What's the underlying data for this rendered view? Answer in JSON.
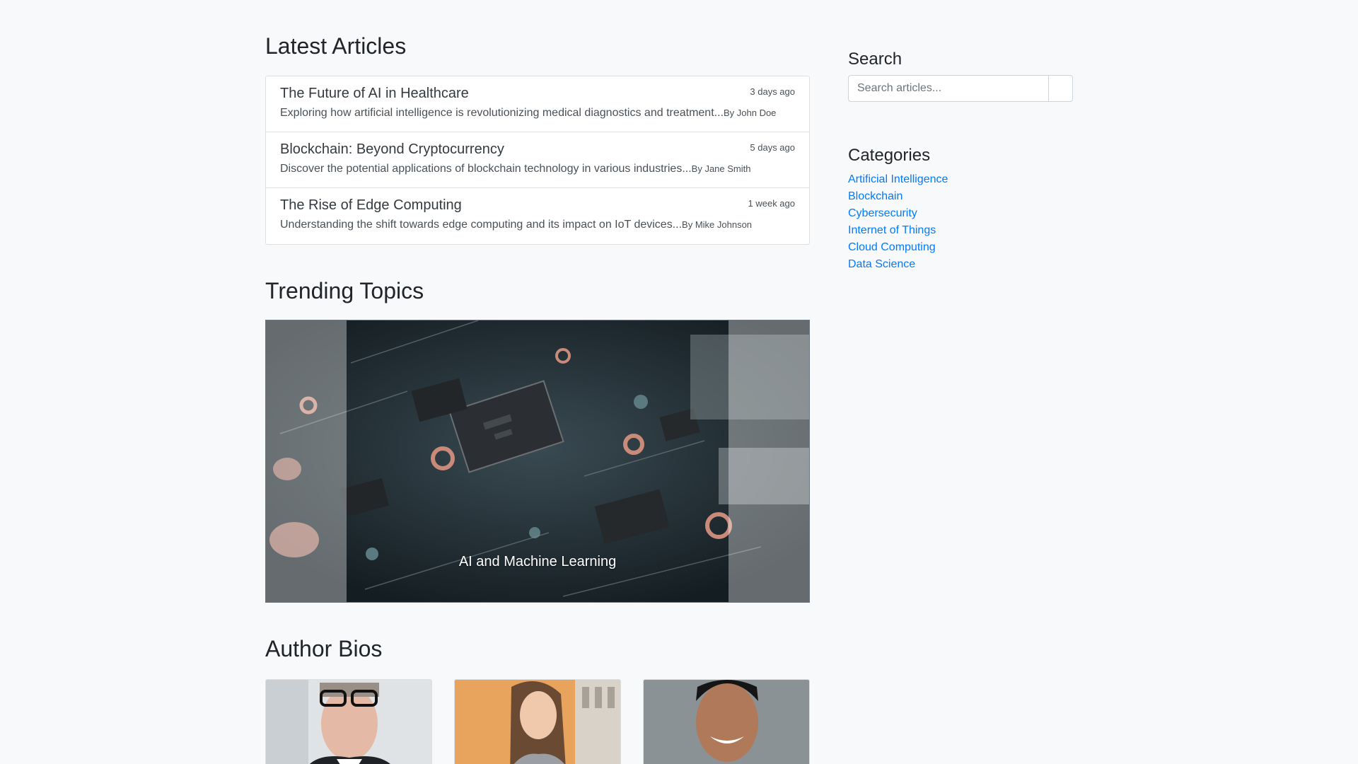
{
  "latest": {
    "title": "Latest Articles",
    "articles": [
      {
        "title": "The Future of AI in Healthcare",
        "time": "3 days ago",
        "description": "Exploring how artificial intelligence is revolutionizing medical diagnostics and treatment...",
        "author": "By John Doe"
      },
      {
        "title": "Blockchain: Beyond Cryptocurrency",
        "time": "5 days ago",
        "description": "Discover the potential applications of blockchain technology in various industries...",
        "author": "By Jane Smith"
      },
      {
        "title": "The Rise of Edge Computing",
        "time": "1 week ago",
        "description": "Understanding the shift towards edge computing and its impact on IoT devices...",
        "author": "By Mike Johnson"
      }
    ]
  },
  "trending": {
    "title": "Trending Topics",
    "slide_caption": "AI and Machine Learning",
    "colors": {
      "board": "#1c2a30",
      "chip": "#2b2f33",
      "copper": "#c98a7a"
    }
  },
  "authors": {
    "title": "Author Bios"
  },
  "sidebar": {
    "search": {
      "title": "Search",
      "placeholder": "Search articles...",
      "value": ""
    },
    "categories": {
      "title": "Categories",
      "items": [
        "Artificial Intelligence",
        "Blockchain",
        "Cybersecurity",
        "Internet of Things",
        "Cloud Computing",
        "Data Science"
      ]
    }
  },
  "colors": {
    "link": "#007bff",
    "page_bg": "#f8f9fa"
  }
}
